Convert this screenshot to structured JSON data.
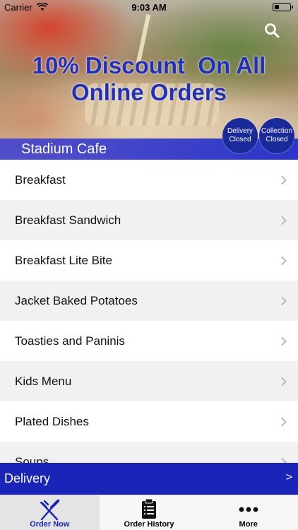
{
  "status_bar": {
    "carrier": "Carrier",
    "time": "9:03 AM"
  },
  "hero": {
    "promo_line1": "10% Discount  On All",
    "promo_line2": "Online Orders",
    "cafe_name": "Stadium Cafe",
    "delivery_status_line1": "Delivery",
    "delivery_status_line2": "Closed",
    "collection_status_line1": "Collection",
    "collection_status_line2": "Closed"
  },
  "menu": {
    "items": [
      {
        "label": "Breakfast"
      },
      {
        "label": "Breakfast Sandwich"
      },
      {
        "label": "Breakfast Lite Bite"
      },
      {
        "label": "Jacket Baked Potatoes"
      },
      {
        "label": "Toasties and Paninis"
      },
      {
        "label": "Kids Menu"
      },
      {
        "label": "Plated Dishes"
      },
      {
        "label": "Soups"
      }
    ]
  },
  "delivery_bar": {
    "label": "Delivery",
    "arrow": ">"
  },
  "tabs": [
    {
      "label": "Order Now",
      "icon": "fork-knife-icon",
      "active": true
    },
    {
      "label": "Order History",
      "icon": "clipboard-icon",
      "active": false
    },
    {
      "label": "More",
      "icon": "more-dots-icon",
      "active": false
    }
  ],
  "colors": {
    "brand_blue": "#1b24b8",
    "promo_text": "#2230b8",
    "badge_blue": "#1b2a9a"
  }
}
